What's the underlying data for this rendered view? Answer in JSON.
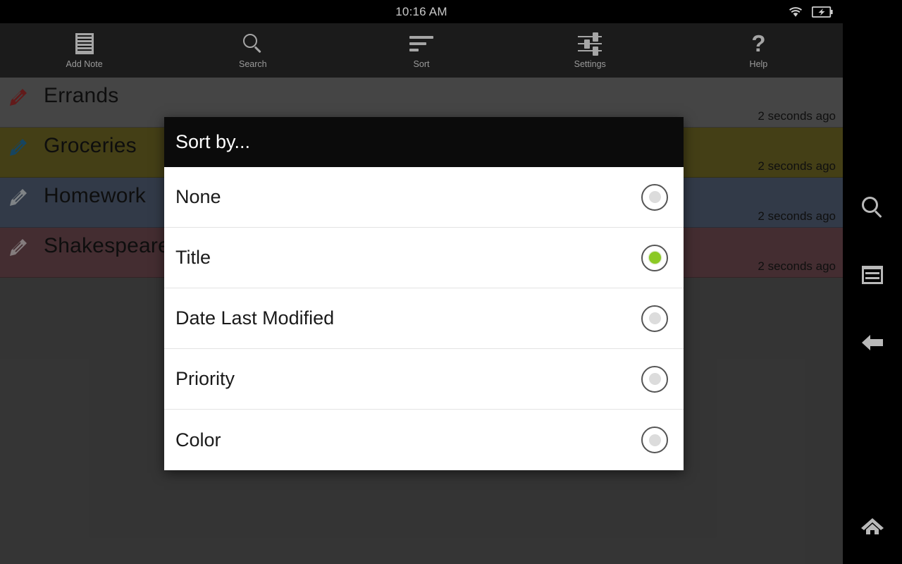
{
  "status_bar": {
    "time": "10:16 AM",
    "wifi_icon": "wifi-icon",
    "battery_icon": "battery-charging-icon"
  },
  "action_bar": {
    "items": [
      {
        "label": "Add Note",
        "icon": "add-note-icon"
      },
      {
        "label": "Search",
        "icon": "search-icon"
      },
      {
        "label": "Sort",
        "icon": "sort-icon"
      },
      {
        "label": "Settings",
        "icon": "settings-sliders-icon"
      },
      {
        "label": "Help",
        "icon": "help-question-icon"
      }
    ]
  },
  "note_list": {
    "rows": [
      {
        "title": "Errands",
        "time": "2 seconds ago",
        "bg": "#7e7e7e",
        "pencil": "#b23030",
        "icon": "pencil-icon"
      },
      {
        "title": "Groceries",
        "time": "2 seconds ago",
        "bg": "#7d7429",
        "pencil": "#2a7fb0",
        "icon": "pencil-icon"
      },
      {
        "title": "Homework",
        "time": "2 seconds ago",
        "bg": "#5c6b83",
        "pencil": "#e8eef5",
        "icon": "pencil-icon"
      },
      {
        "title": "Shakespeare",
        "time": "2 seconds ago",
        "bg": "#7c5359",
        "pencil": "#f0e2e4",
        "icon": "pencil-icon"
      }
    ]
  },
  "dialog": {
    "title": "Sort by...",
    "selected": "Title",
    "options": [
      {
        "label": "None",
        "checked": false
      },
      {
        "label": "Title",
        "checked": true
      },
      {
        "label": "Date Last Modified",
        "checked": false
      },
      {
        "label": "Priority",
        "checked": false
      },
      {
        "label": "Color",
        "checked": false
      }
    ],
    "accent_color": "#8bc924"
  },
  "nav_bar": {
    "buttons": [
      {
        "name": "search",
        "icon": "search-icon"
      },
      {
        "name": "recents",
        "icon": "recents-icon"
      },
      {
        "name": "back",
        "icon": "back-arrow-icon"
      },
      {
        "name": "home",
        "icon": "home-icon"
      }
    ]
  }
}
